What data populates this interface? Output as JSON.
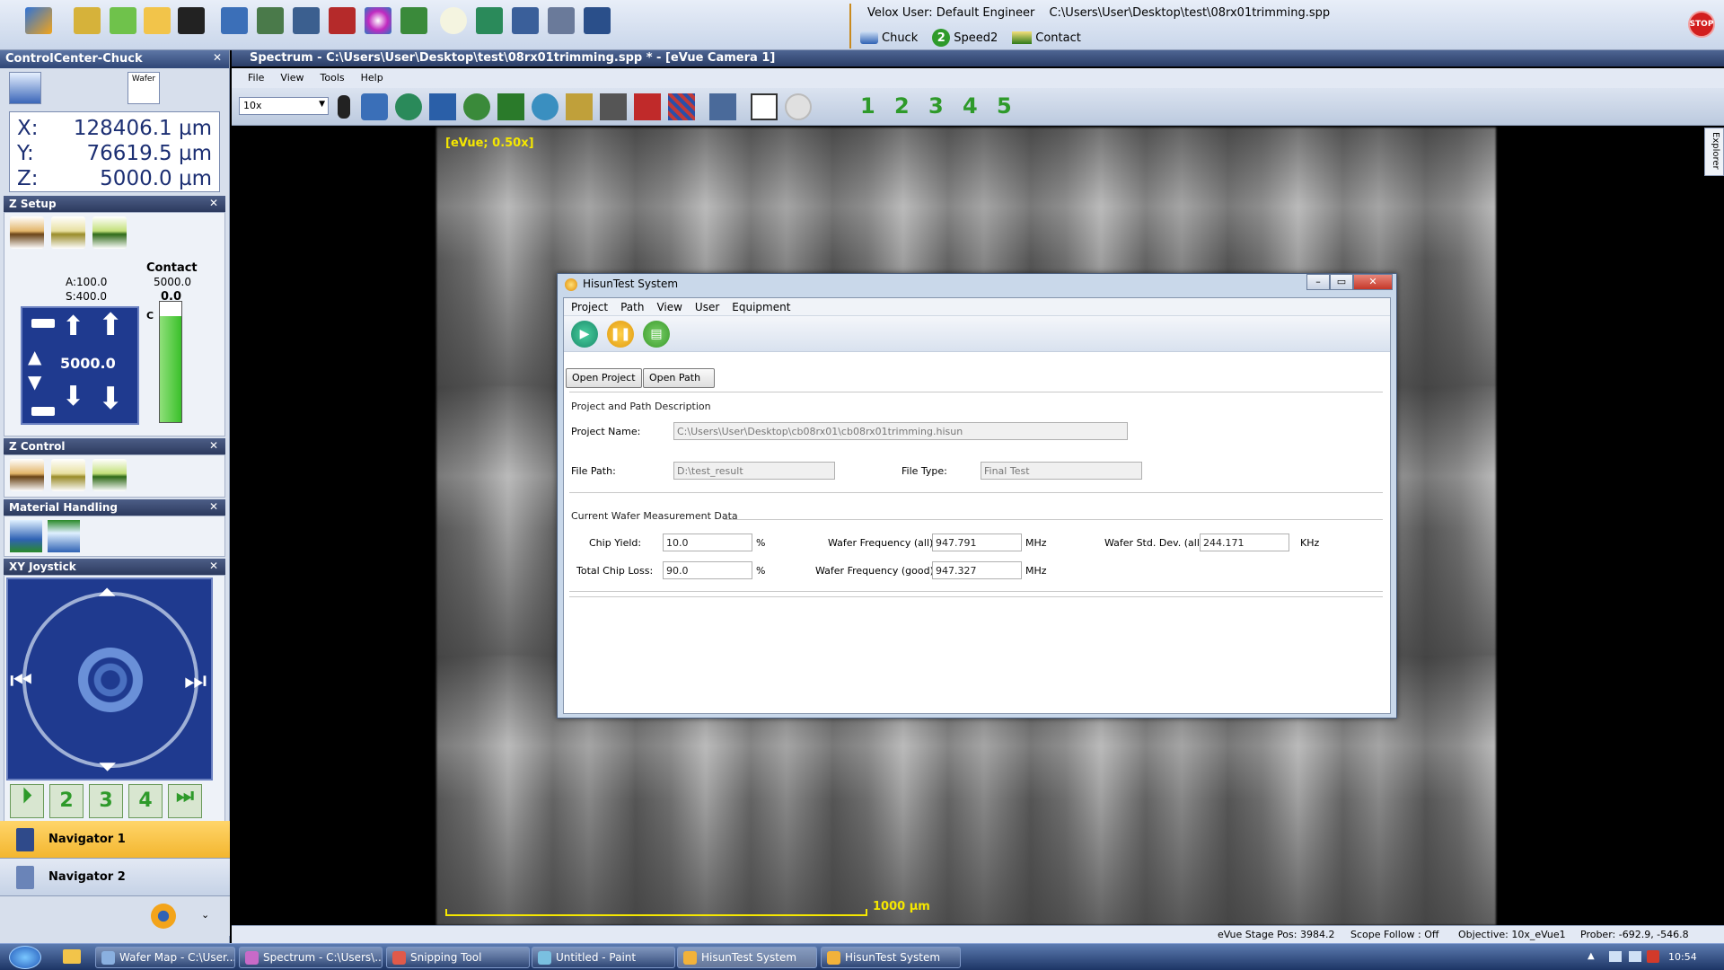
{
  "top": {
    "user_line": "Velox User: Default Engineer",
    "file_path": "C:\\Users\\User\\Desktop\\test\\08rx01trimming.spp",
    "chuck_label": "Chuck",
    "speed_label": "Speed2",
    "speed_number": "2",
    "contact_label": "Contact",
    "stop_label": "STOP"
  },
  "control_center": {
    "title": "ControlCenter-Chuck",
    "wafer_label": "Wafer",
    "x_label": "X:",
    "x_value": "128406.1 µm",
    "y_label": "Y:",
    "y_value": "76619.5 µm",
    "z_label": "Z:",
    "z_value": "5000.0 µm"
  },
  "z_setup": {
    "title": "Z Setup",
    "a_value": "A:100.0",
    "s_value": "S:400.0",
    "contact_title": "Contact",
    "contact_value": "5000.0",
    "contact_offset": "0.0",
    "pad_value": "5000.0",
    "c_label": "C"
  },
  "z_control": {
    "title": "Z Control"
  },
  "material_handling": {
    "title": "Material Handling"
  },
  "xy_joystick": {
    "title": "XY Joystick",
    "steps": [
      "2",
      "3",
      "4"
    ]
  },
  "navigators": [
    {
      "label": "Navigator 1"
    },
    {
      "label": "Navigator 2"
    }
  ],
  "main_window": {
    "title": "Spectrum - C:\\Users\\User\\Desktop\\test\\08rx01trimming.spp *   - [eVue Camera 1]",
    "menu": [
      "File",
      "View",
      "Tools",
      "Help"
    ],
    "zoom_value": "10x",
    "preset_buttons": [
      "1",
      "2",
      "3",
      "4",
      "5"
    ],
    "camera_label": "[eVue; 0.50x]",
    "scale_label": "1000 µm",
    "explorer_tab": "Explorer"
  },
  "statusbar": {
    "stage_pos": "eVue Stage Pos: 3984.2",
    "scope_follow": "Scope Follow : Off",
    "objective": "Objective: 10x_eVue1",
    "prober": "Prober:  -692.9,  -546.8"
  },
  "dialog": {
    "title": "HisunTest System",
    "menu": [
      "Project",
      "Path",
      "View",
      "User",
      "Equipment"
    ],
    "open_project_label": "Open Project",
    "open_path_label": "Open  Path",
    "project_group_title": "Project and Path Description",
    "project_name_label": "Project Name:",
    "project_name_value": "C:\\Users\\User\\Desktop\\cb08rx01\\cb08rx01trimming.hisun",
    "file_path_label": "File Path:",
    "file_path_value": "D:\\test_result",
    "file_type_label": "File Type:",
    "file_type_value": "Final Test",
    "wafer_group_title": "Current Wafer Measurement Data",
    "chip_yield_label": "Chip Yield:",
    "chip_yield_value": "10.0",
    "chip_yield_unit": "%",
    "total_chip_loss_label": "Total Chip Loss:",
    "total_chip_loss_value": "90.0",
    "total_chip_loss_unit": "%",
    "freq_all_label": "Wafer Frequency (all):",
    "freq_all_value": "947.791",
    "freq_all_unit": "MHz",
    "freq_good_label": "Wafer Frequency (good):",
    "freq_good_value": "947.327",
    "freq_good_unit": "MHz",
    "std_dev_label": "Wafer Std. Dev. (all):",
    "std_dev_value": "244.171",
    "std_dev_unit": "KHz"
  },
  "taskbar": {
    "items": [
      "Wafer Map - C:\\User...",
      "Spectrum - C:\\Users\\...",
      "Snipping Tool",
      "Untitled - Paint",
      "HisunTest System",
      "HisunTest System"
    ],
    "time": "10:54"
  },
  "colors": {
    "accent_blue": "#1f3a8f",
    "eVue_yellow": "#f5e700",
    "preset_green": "#2e9a2a",
    "stop_red": "#d21e1e",
    "navigator_active": "#f3b62f"
  }
}
